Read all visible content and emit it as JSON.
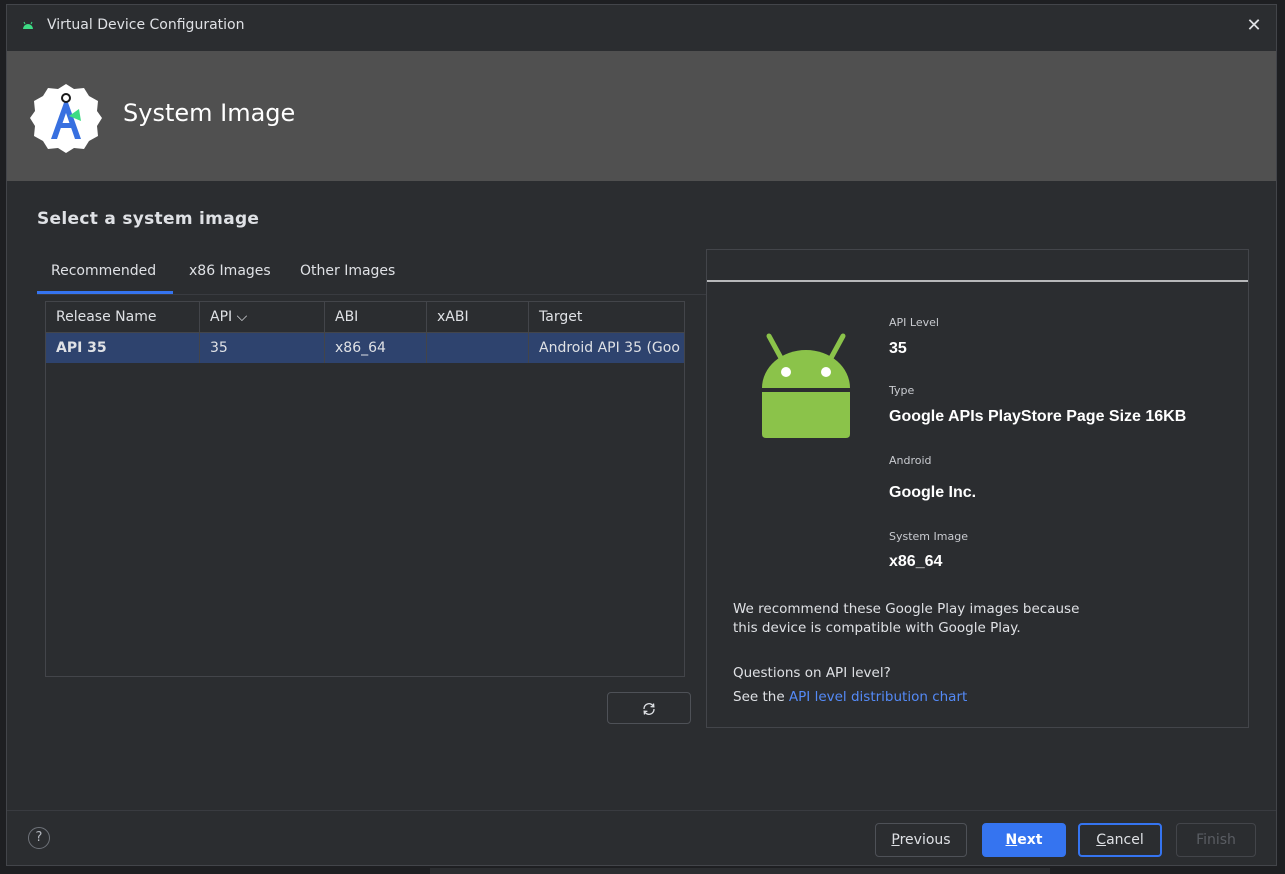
{
  "window": {
    "title": "Virtual Device Configuration",
    "close_glyph": "✕"
  },
  "header": {
    "title": "System Image"
  },
  "section_title": "Select a system image",
  "tabs": [
    {
      "label": "Recommended",
      "active": true
    },
    {
      "label": "x86 Images",
      "active": false
    },
    {
      "label": "Other Images",
      "active": false
    }
  ],
  "table": {
    "columns": [
      "Release Name",
      "API ⌵",
      "ABI",
      "xABI",
      "Target"
    ],
    "rows": [
      {
        "release_name": "API 35",
        "api": "35",
        "abi": "x86_64",
        "xabi": "",
        "target": "Android API 35 (Goo",
        "selected": true
      }
    ]
  },
  "refresh_icon": "refresh-icon",
  "details": {
    "api_level_label": "API Level",
    "api_level": "35",
    "type_label": "Type",
    "type": "Google APIs PlayStore Page Size 16KB",
    "android_label": "Android",
    "android": "Google Inc.",
    "system_image_label": "System Image",
    "system_image": "x86_64",
    "recommend_line1": "We recommend these Google Play images because",
    "recommend_line2": "this device is compatible with Google Play.",
    "question": "Questions on API level?",
    "see_prefix": "See the ",
    "see_link": "API level distribution chart"
  },
  "footer": {
    "help": "?",
    "previous_first": "P",
    "previous_rest": "revious",
    "next_first": "N",
    "next_rest": "ext",
    "cancel_first": "C",
    "cancel_rest": "ancel",
    "finish": "Finish"
  },
  "colors": {
    "accent": "#3574f0",
    "selection": "#2e436e",
    "header_bg": "#505050",
    "android_green": "#8bc34a",
    "link": "#548af7"
  }
}
